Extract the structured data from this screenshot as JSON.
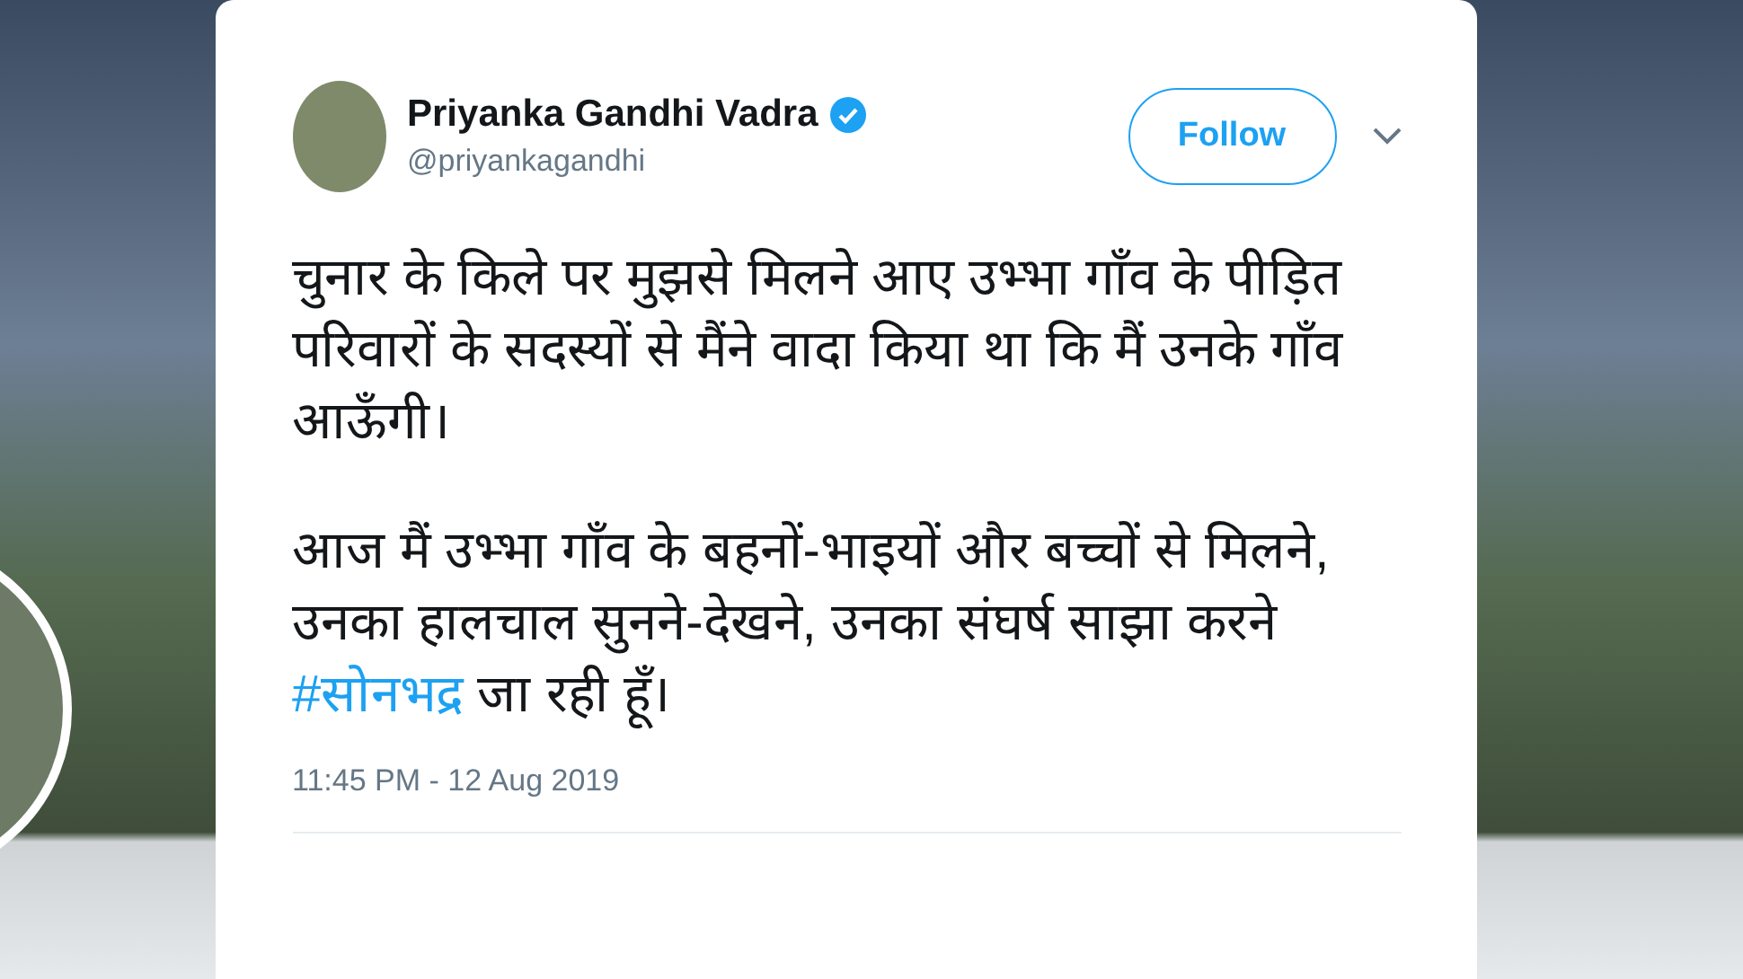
{
  "author": {
    "name": "Priyanka Gandhi Vadra",
    "verified": true,
    "handle": "@priyankagandhi"
  },
  "follow_button": {
    "label": "Follow"
  },
  "paragraphs": [
    {
      "text": "चुनार के किले पर मुझसे मिलने आए उभ्भा गाँव के पीड़ित परिवारों के सदस्यों से मैंने वादा किया था कि मैं उनके गाँव आऊँगी।"
    },
    {
      "text": "आज मैं उभ्भा गाँव के बहनों-भाइयों और बच्चों से मिलने, उनका हालचाल सुनने-देखने, उनका संघर्ष साझा करने ",
      "hashtag": "#सोनभद्र",
      "text_after": " जा रही हूँ।"
    }
  ],
  "timestamp": "11:45 PM - 12 Aug 2019"
}
